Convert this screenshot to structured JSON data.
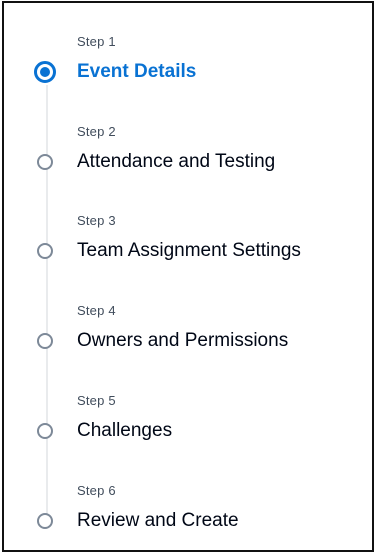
{
  "steps": [
    {
      "index_label": "Step 1",
      "title": "Event Details",
      "state": "active"
    },
    {
      "index_label": "Step 2",
      "title": "Attendance and Testing",
      "state": "pending"
    },
    {
      "index_label": "Step 3",
      "title": "Team Assignment Settings",
      "state": "pending"
    },
    {
      "index_label": "Step 4",
      "title": "Owners and Permissions",
      "state": "pending"
    },
    {
      "index_label": "Step 5",
      "title": "Challenges",
      "state": "pending"
    },
    {
      "index_label": "Step 6",
      "title": "Review and Create",
      "state": "pending"
    }
  ],
  "colors": {
    "active": "#0972d3",
    "inactive_marker": "#7d8998",
    "rail": "#e9ebed",
    "frame_border": "#111111"
  }
}
